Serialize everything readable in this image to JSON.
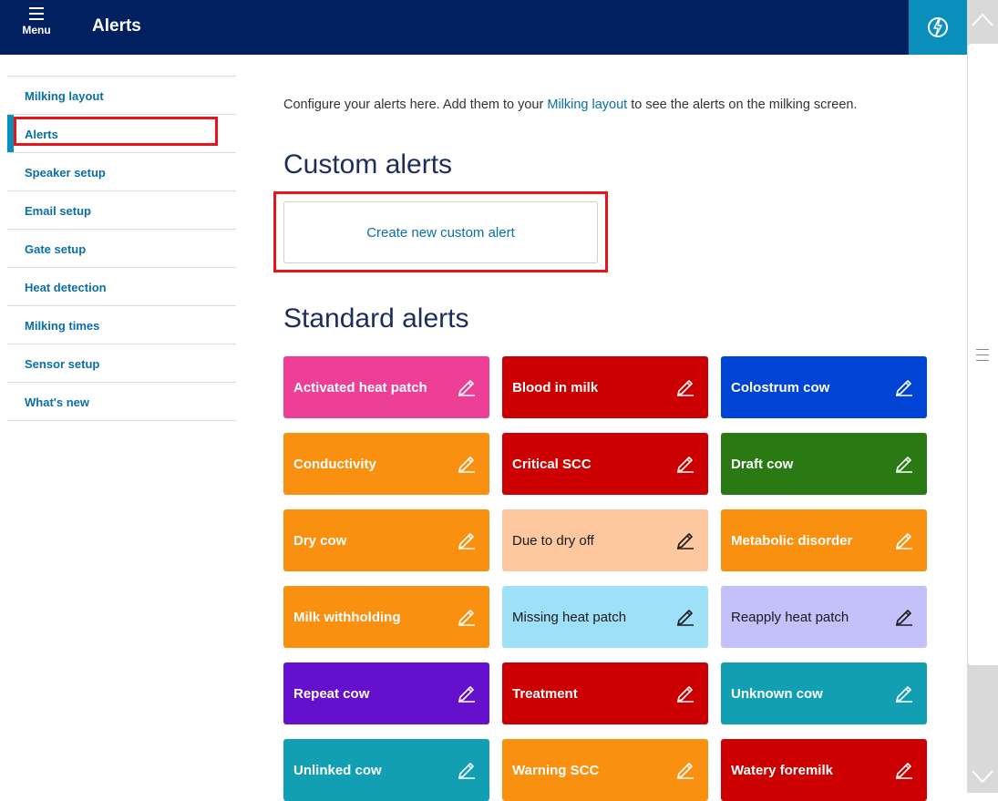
{
  "header": {
    "menu_label": "Menu",
    "title": "Alerts",
    "menu_icon": "hamburger-icon",
    "power_icon": "power-off-icon"
  },
  "sidebar": {
    "items": [
      {
        "label": "Milking layout"
      },
      {
        "label": "Alerts",
        "active": true
      },
      {
        "label": "Speaker setup"
      },
      {
        "label": "Email setup"
      },
      {
        "label": "Gate setup"
      },
      {
        "label": "Heat detection"
      },
      {
        "label": "Milking times"
      },
      {
        "label": "Sensor setup"
      },
      {
        "label": "What's new"
      }
    ]
  },
  "main": {
    "intro_before": "Configure your alerts here. Add them to your ",
    "intro_link": "Milking layout",
    "intro_after": " to see the alerts on the milking screen.",
    "custom_heading": "Custom alerts",
    "create_button": "Create new custom alert",
    "standard_heading": "Standard alerts"
  },
  "alerts": [
    {
      "label": "Activated heat patch",
      "color": "#ed3f96",
      "text": "light"
    },
    {
      "label": "Blood in milk",
      "color": "#cc0000",
      "text": "light"
    },
    {
      "label": "Colostrum cow",
      "color": "#0044d6",
      "text": "light"
    },
    {
      "label": "Conductivity",
      "color": "#f9900f",
      "text": "light"
    },
    {
      "label": "Critical SCC",
      "color": "#cc0000",
      "text": "light"
    },
    {
      "label": "Draft cow",
      "color": "#2a7a14",
      "text": "light"
    },
    {
      "label": "Dry cow",
      "color": "#f9900f",
      "text": "light"
    },
    {
      "label": "Due to dry off",
      "color": "#fdc8a0",
      "text": "dark"
    },
    {
      "label": "Metabolic disorder",
      "color": "#f9900f",
      "text": "light"
    },
    {
      "label": "Milk withholding",
      "color": "#f9900f",
      "text": "light"
    },
    {
      "label": "Missing heat patch",
      "color": "#9de0f8",
      "text": "dark"
    },
    {
      "label": "Reapply heat patch",
      "color": "#c4c0fa",
      "text": "dark"
    },
    {
      "label": "Repeat cow",
      "color": "#6410cc",
      "text": "light"
    },
    {
      "label": "Treatment",
      "color": "#cc0000",
      "text": "light"
    },
    {
      "label": "Unknown cow",
      "color": "#129fb3",
      "text": "light"
    },
    {
      "label": "Unlinked cow",
      "color": "#129fb3",
      "text": "light"
    },
    {
      "label": "Warning SCC",
      "color": "#f9900f",
      "text": "light"
    },
    {
      "label": "Watery foremilk",
      "color": "#cc0000",
      "text": "light"
    }
  ],
  "colors": {
    "header_bg": "#002060",
    "accent": "#0a8fbd",
    "link": "#0a6fa8",
    "highlight": "#e8141a"
  }
}
